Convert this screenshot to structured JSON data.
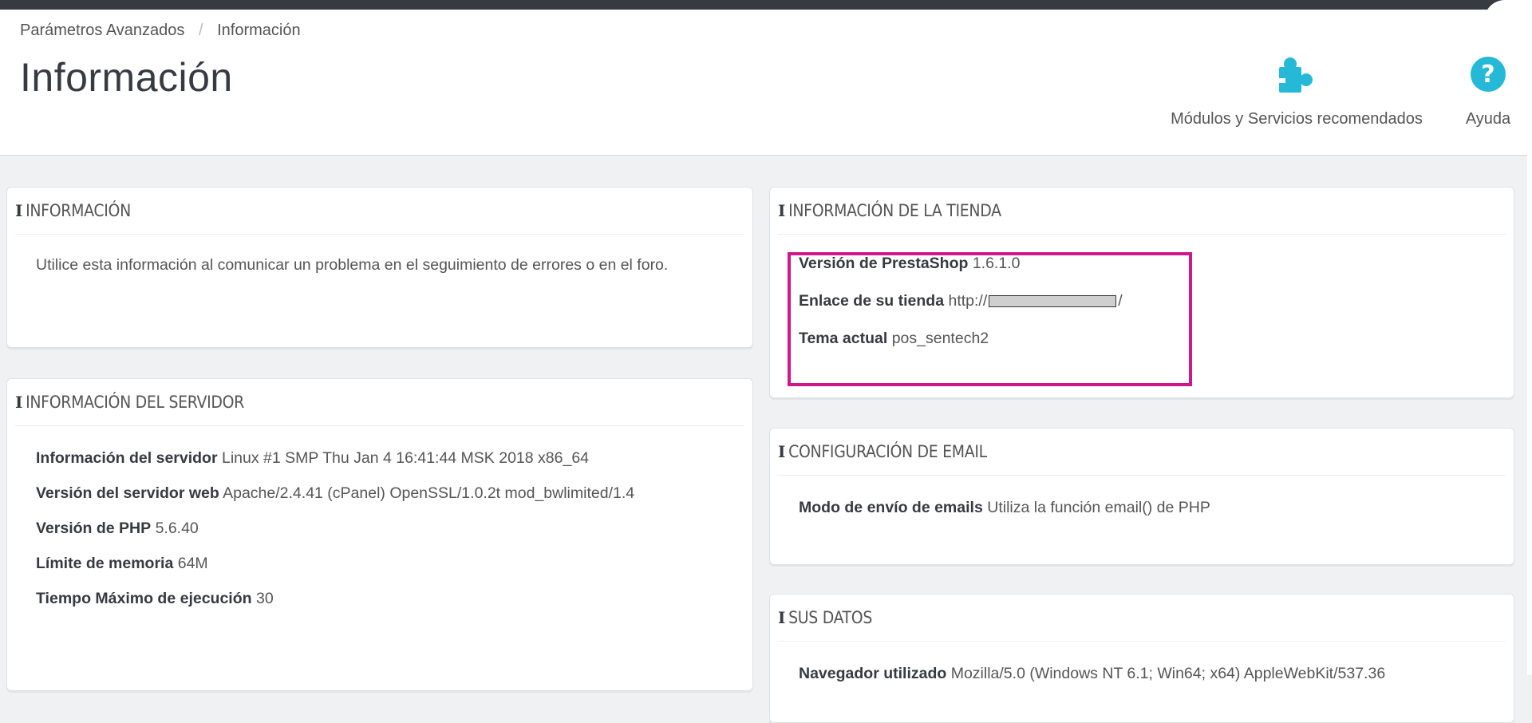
{
  "breadcrumb": {
    "parent": "Parámetros Avanzados",
    "separator": "/",
    "current": "Información"
  },
  "page_title": "Información",
  "toolbar": {
    "modules_label": "Módulos y Servicios recomendados",
    "modules_icon": "puzzle-icon",
    "help_label": "Ayuda",
    "help_icon": "question-circle-icon"
  },
  "colors": {
    "accent": "#25b9d7",
    "highlight": "#d0168a",
    "topbar": "#363a41"
  },
  "panels": {
    "info": {
      "title": "Información",
      "text": "Utilice esta información al comunicar un problema en el seguimiento de errores o en el foro."
    },
    "store": {
      "title": "Información de la tienda",
      "rows": [
        {
          "label": "Versión de PrestaShop",
          "value": "1.6.1.0"
        },
        {
          "label": "Enlace de su tienda",
          "value_prefix": "http://",
          "value_suffix": "/"
        },
        {
          "label": "Tema actual",
          "value": "pos_sentech2"
        }
      ]
    },
    "server": {
      "title": "Información del servidor",
      "rows": [
        {
          "label": "Información del servidor",
          "value": "Linux #1 SMP Thu Jan 4 16:41:44 MSK 2018 x86_64"
        },
        {
          "label": "Versión del servidor web",
          "value": "Apache/2.4.41 (cPanel) OpenSSL/1.0.2t mod_bwlimited/1.4"
        },
        {
          "label": "Versión de PHP",
          "value": "5.6.40"
        },
        {
          "label": "Límite de memoria",
          "value": "64M"
        },
        {
          "label": "Tiempo Máximo de ejecución",
          "value": "30"
        }
      ]
    },
    "email": {
      "title": "Configuración de email",
      "rows": [
        {
          "label": "Modo de envío de emails",
          "value": "Utiliza la función email() de PHP"
        }
      ]
    },
    "data": {
      "title": "Sus datos",
      "rows": [
        {
          "label": "Navegador utilizado",
          "value": "Mozilla/5.0 (Windows NT 6.1; Win64; x64) AppleWebKit/537.36"
        }
      ]
    }
  }
}
